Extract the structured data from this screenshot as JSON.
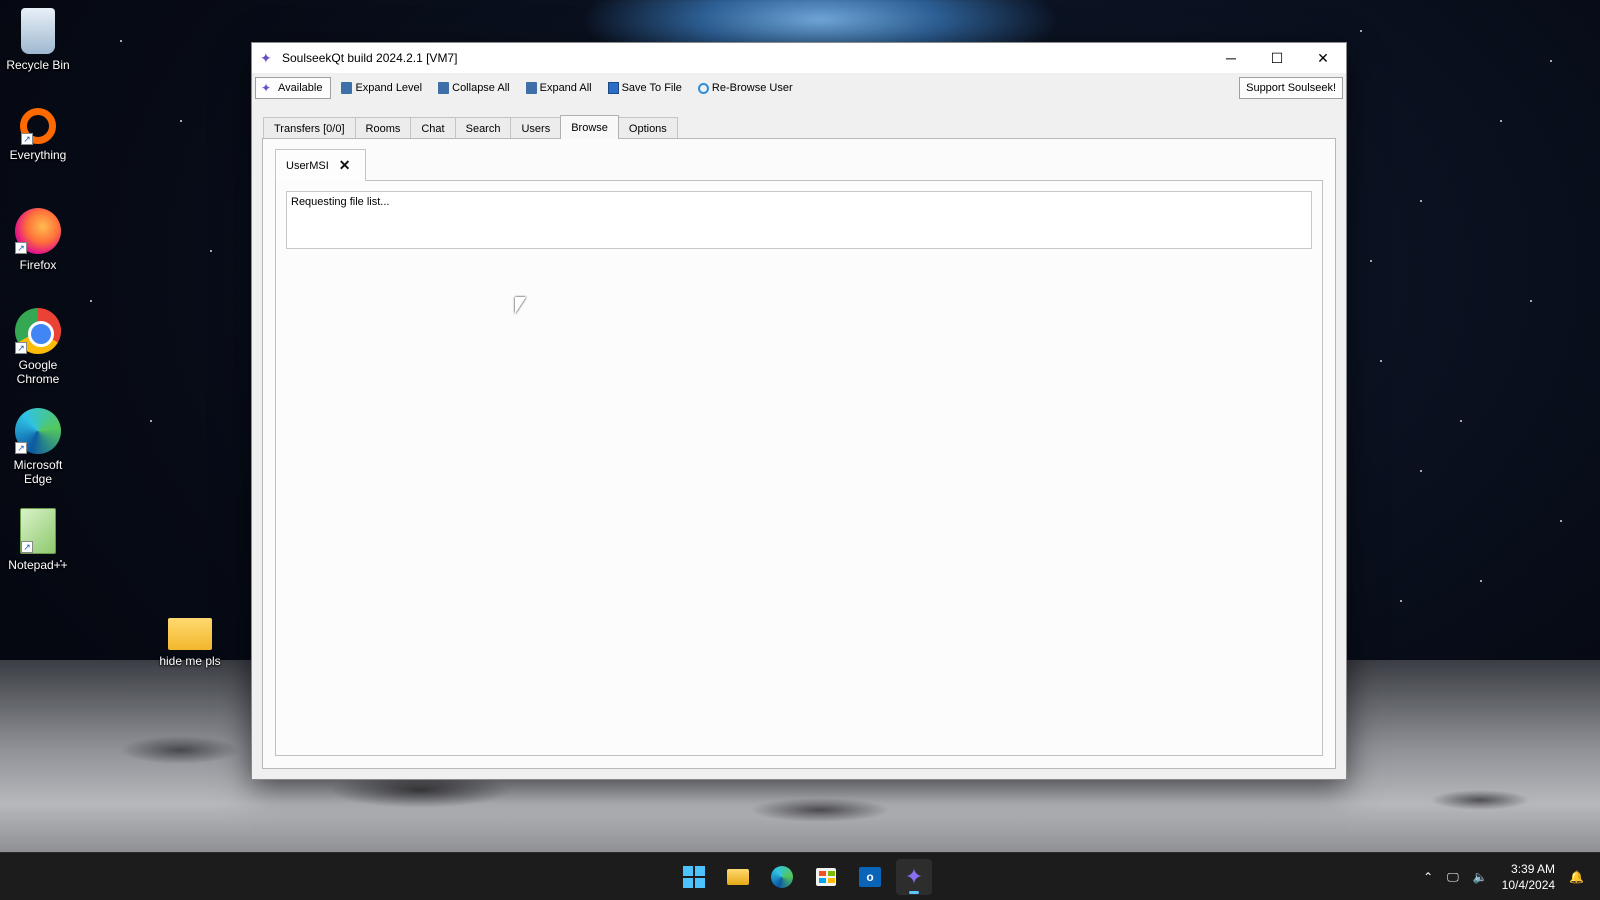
{
  "desktop": {
    "icons": [
      {
        "label": "Recycle Bin"
      },
      {
        "label": "Everything"
      },
      {
        "label": "Firefox"
      },
      {
        "label": "Google Chrome"
      },
      {
        "label": "Microsoft Edge"
      },
      {
        "label": "Notepad++"
      },
      {
        "label": "hide me pls"
      }
    ]
  },
  "window": {
    "title": "SoulseekQt build 2024.2.1 [VM7]",
    "controls": {
      "minimize": "─",
      "maximize": "☐",
      "close": "✕"
    }
  },
  "toolbar": {
    "status": "Available",
    "expand_level": "Expand Level",
    "collapse_all": "Collapse All",
    "expand_all": "Expand All",
    "save_to_file": "Save To File",
    "rebrowse_user": "Re-Browse User",
    "support": "Support Soulseek!"
  },
  "tabs": [
    {
      "label": "Transfers [0/0]"
    },
    {
      "label": "Rooms"
    },
    {
      "label": "Chat"
    },
    {
      "label": "Search"
    },
    {
      "label": "Users"
    },
    {
      "label": "Browse",
      "active": true
    },
    {
      "label": "Options"
    }
  ],
  "browse": {
    "user_tab": "UserMSI",
    "close_glyph": "✕",
    "status_text": "Requesting file list..."
  },
  "taskbar": {
    "time": "3:39 AM",
    "date": "10/4/2024"
  },
  "colors": {
    "accent": "#4cc2ff",
    "soulseek_purple": "#6a4fc9"
  }
}
